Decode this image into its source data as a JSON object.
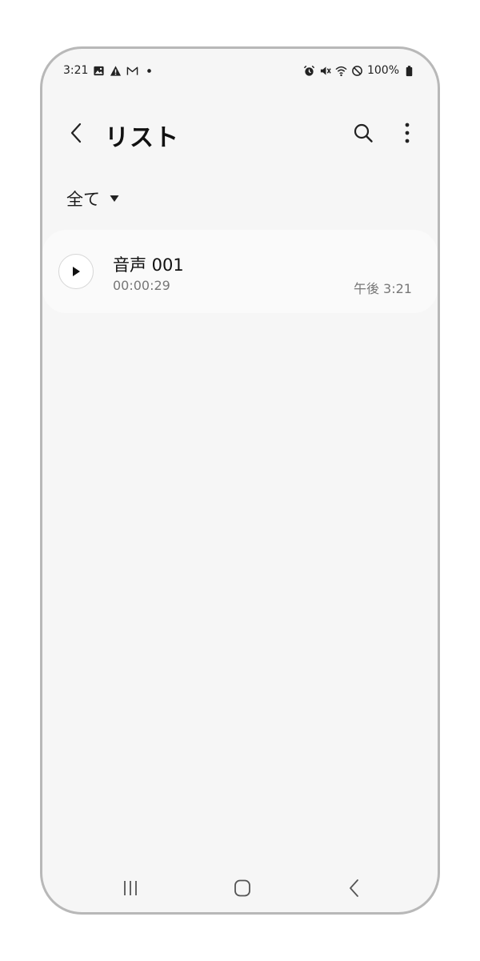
{
  "status_bar": {
    "time": "3:21",
    "battery": "100%",
    "left_icons": [
      "gallery-icon",
      "warning-icon",
      "gmail-icon",
      "dot-icon"
    ],
    "right_icons": [
      "alarm-icon",
      "mute-icon",
      "wifi-icon",
      "dnd-icon",
      "battery-icon"
    ]
  },
  "header": {
    "title": "リスト"
  },
  "filter": {
    "label": "全て"
  },
  "recordings": [
    {
      "name": "音声 001",
      "duration": "00:00:29",
      "time": "午後 3:21"
    }
  ]
}
